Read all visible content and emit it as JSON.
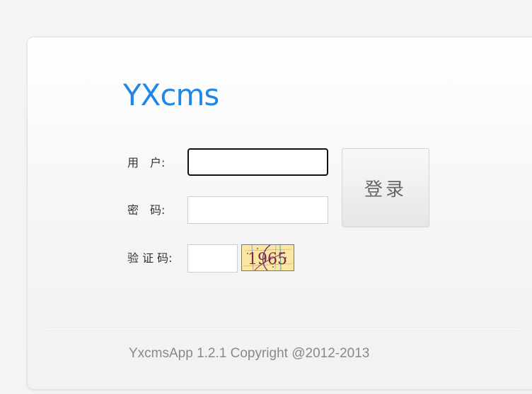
{
  "logo": {
    "text": "YXcms"
  },
  "form": {
    "username_label": "用　户:",
    "username_value": "",
    "password_label": "密　码:",
    "password_value": "",
    "captcha_label": "验 证 码:",
    "captcha_value": "",
    "captcha_image_text": "1965",
    "login_button": "登录"
  },
  "footer": {
    "copyright": "YxcmsApp 1.2.1 Copyright @2012-2013"
  },
  "colors": {
    "logo": "#1f87e5",
    "captcha_background": "#fbe6a4",
    "captcha_text": "#7a2a4a"
  }
}
